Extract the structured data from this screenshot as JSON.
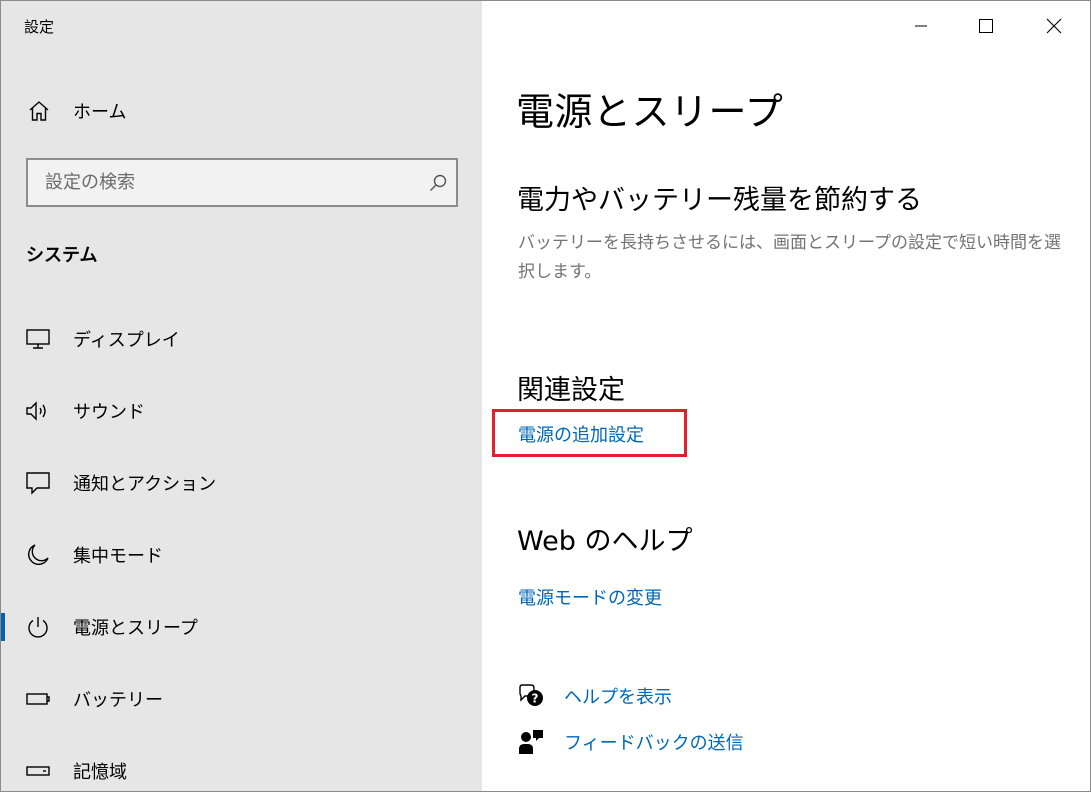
{
  "window": {
    "app_title": "設定",
    "controls": [
      "minimize",
      "maximize",
      "close"
    ]
  },
  "sidebar": {
    "home_label": "ホーム",
    "search": {
      "placeholder": "設定の検索",
      "value": ""
    },
    "section_title": "システム",
    "items": [
      {
        "label": "ディスプレイ",
        "icon": "monitor-icon",
        "active": false
      },
      {
        "label": "サウンド",
        "icon": "speaker-icon",
        "active": false
      },
      {
        "label": "通知とアクション",
        "icon": "notification-icon",
        "active": false
      },
      {
        "label": "集中モード",
        "icon": "moon-icon",
        "active": false
      },
      {
        "label": "電源とスリープ",
        "icon": "power-icon",
        "active": true
      },
      {
        "label": "バッテリー",
        "icon": "battery-icon",
        "active": false
      },
      {
        "label": "記憶域",
        "icon": "storage-icon",
        "active": false
      }
    ]
  },
  "main": {
    "page_title": "電源とスリープ",
    "save_power": {
      "heading": "電力やバッテリー残量を節約する",
      "description": "バッテリーを長持ちさせるには、画面とスリープの設定で短い時間を選択します。"
    },
    "related": {
      "heading": "関連設定",
      "link": "電源の追加設定"
    },
    "web_help": {
      "heading": "Web のヘルプ",
      "link": "電源モードの変更"
    },
    "footer": {
      "help_link": "ヘルプを表示",
      "feedback_link": "フィードバックの送信"
    }
  },
  "colors": {
    "sidebar_bg": "#e6e6e6",
    "accent": "#0063b1",
    "link": "#0067b8",
    "highlight": "#e0202e"
  }
}
